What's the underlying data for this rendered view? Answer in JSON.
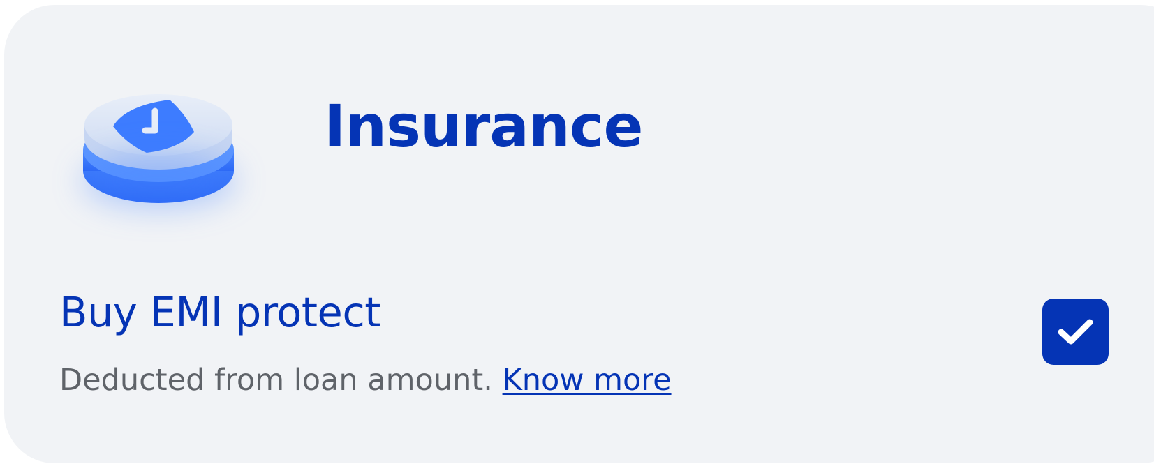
{
  "section": {
    "title": "Insurance",
    "icon": "shield-clock-icon"
  },
  "option": {
    "title": "Buy EMI protect",
    "subtitle": "Deducted from loan amount.",
    "link_label": "Know more",
    "checked": true
  },
  "colors": {
    "card_background": "#f1f3f6",
    "primary": "#0534b5",
    "icon_blue": "#3d7cff",
    "subtitle_gray": "#5f6369"
  }
}
